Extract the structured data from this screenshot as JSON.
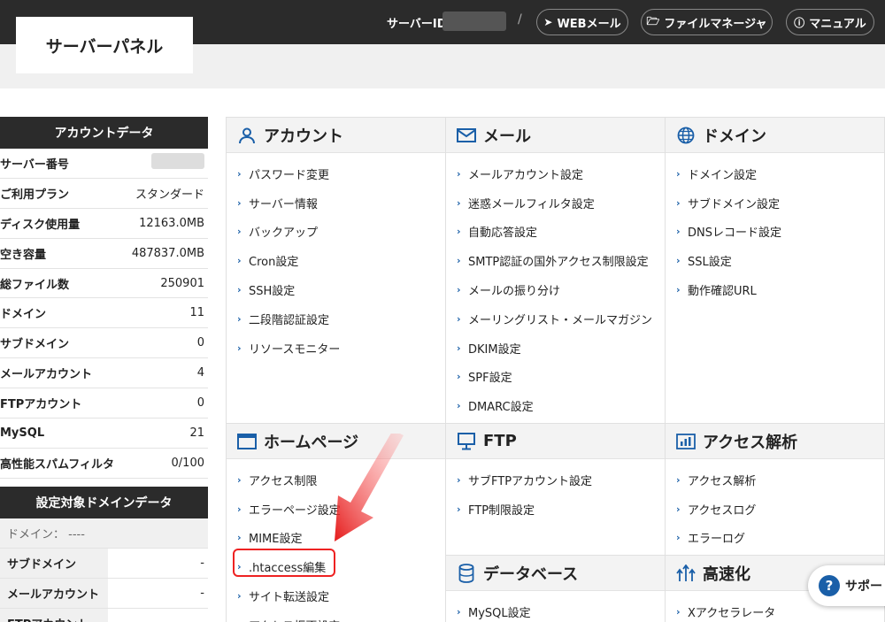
{
  "header": {
    "logo": "サーバーパネル",
    "server_id_label": "サーバーID",
    "slash": "/",
    "buttons": [
      {
        "label": "WEBメール",
        "icon": "paper-plane-icon"
      },
      {
        "label": "ファイルマネージャ",
        "icon": "folder-icon"
      },
      {
        "label": "マニュアル",
        "icon": "question-icon"
      }
    ]
  },
  "account_data": {
    "title": "アカウントデータ",
    "rows": [
      {
        "label": "サーバー番号",
        "value": ""
      },
      {
        "label": "ご利用プラン",
        "value": "スタンダード"
      },
      {
        "label": "ディスク使用量",
        "value": "12163.0MB"
      },
      {
        "label": "空き容量",
        "value": "487837.0MB"
      },
      {
        "label": "総ファイル数",
        "value": "250901"
      },
      {
        "label": "ドメイン",
        "value": "11"
      },
      {
        "label": "サブドメイン",
        "value": "0"
      },
      {
        "label": "メールアカウント",
        "value": "4"
      },
      {
        "label": "FTPアカウント",
        "value": "0"
      },
      {
        "label": "MySQL",
        "value": "21"
      },
      {
        "label": "高性能スパムフィルタ",
        "value": "0/100"
      }
    ]
  },
  "domain_data": {
    "title": "設定対象ドメインデータ",
    "domain_line": "ドメイン： ----",
    "rows": [
      {
        "label": "サブドメイン",
        "value": "-"
      },
      {
        "label": "メールアカウント",
        "value": "-"
      },
      {
        "label": "FTPアカウント",
        "value": "-"
      }
    ]
  },
  "menus": {
    "account": {
      "title": "アカウント",
      "items": [
        "パスワード変更",
        "サーバー情報",
        "バックアップ",
        "Cron設定",
        "SSH設定",
        "二段階認証設定",
        "リソースモニター"
      ]
    },
    "mail": {
      "title": "メール",
      "items": [
        "メールアカウント設定",
        "迷惑メールフィルタ設定",
        "自動応答設定",
        "SMTP認証の国外アクセス制限設定",
        "メールの振り分け",
        "メーリングリスト・メールマガジン",
        "DKIM設定",
        "SPF設定",
        "DMARC設定"
      ]
    },
    "domain": {
      "title": "ドメイン",
      "items": [
        "ドメイン設定",
        "サブドメイン設定",
        "DNSレコード設定",
        "SSL設定",
        "動作確認URL"
      ]
    },
    "homepage": {
      "title": "ホームページ",
      "items": [
        "アクセス制限",
        "エラーページ設定",
        "MIME設定",
        ".htaccess編集",
        "サイト転送設定",
        "アクセス拒否設定"
      ]
    },
    "ftp": {
      "title": "FTP",
      "items": [
        "サブFTPアカウント設定",
        "FTP制限設定"
      ]
    },
    "analytics": {
      "title": "アクセス解析",
      "items": [
        "アクセス解析",
        "アクセスログ",
        "エラーログ"
      ]
    },
    "database": {
      "title": "データベース",
      "items": [
        "MySQL設定"
      ]
    },
    "speed": {
      "title": "高速化",
      "items": [
        "Xアクセラレータ"
      ]
    }
  },
  "support": {
    "label": "サポー"
  },
  "colors": {
    "accent": "#1a5fa8",
    "highlight": "#e22222",
    "dark": "#2b2b2b"
  }
}
